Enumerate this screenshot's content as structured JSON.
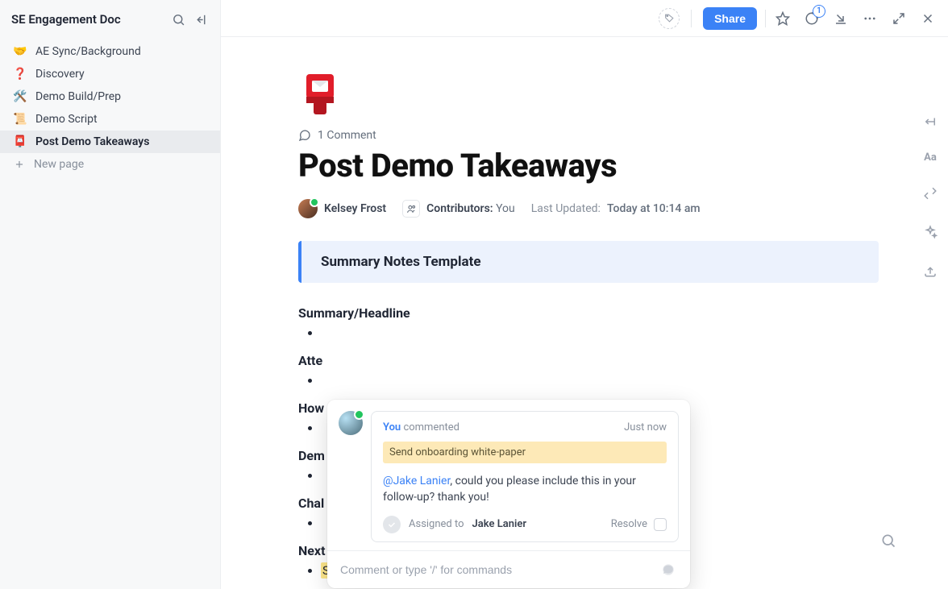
{
  "sidebar": {
    "title": "SE Engagement Doc",
    "items": [
      {
        "emoji": "🤝",
        "label": "AE Sync/Background"
      },
      {
        "emoji": "❓",
        "label": "Discovery"
      },
      {
        "emoji": "🛠️",
        "label": "Demo Build/Prep"
      },
      {
        "emoji": "📜",
        "label": "Demo Script"
      },
      {
        "emoji": "📮",
        "label": "Post Demo Takeaways"
      }
    ],
    "new_page": "New page"
  },
  "topbar": {
    "share": "Share",
    "notifications": "1"
  },
  "doc": {
    "comment_count": "1 Comment",
    "title": "Post Demo Takeaways",
    "author": "Kelsey Frost",
    "contributors_label": "Contributors:",
    "contributors_value": "You",
    "updated_label": "Last Updated:",
    "updated_value": "Today at 10:14 am",
    "callout": "Summary Notes Template",
    "sections": {
      "s1": "Summary/Headline",
      "s2": "Atte",
      "s3": "How",
      "s4": "Dem",
      "s5": "Chal",
      "s6": "Next"
    },
    "highlighted_item": "Send onboarding white-paper"
  },
  "comment": {
    "you": "You",
    "verb": "commented",
    "time": "Just now",
    "quote": "Send onboarding white-paper",
    "mention": "@Jake Lanier",
    "body_rest": ", could you please include this in your follow-up? thank you!",
    "assigned_label": "Assigned to",
    "assignee": "Jake Lanier",
    "resolve": "Resolve",
    "input_placeholder": "Comment or type '/' for commands"
  },
  "rail": {
    "aa": "Aa"
  }
}
